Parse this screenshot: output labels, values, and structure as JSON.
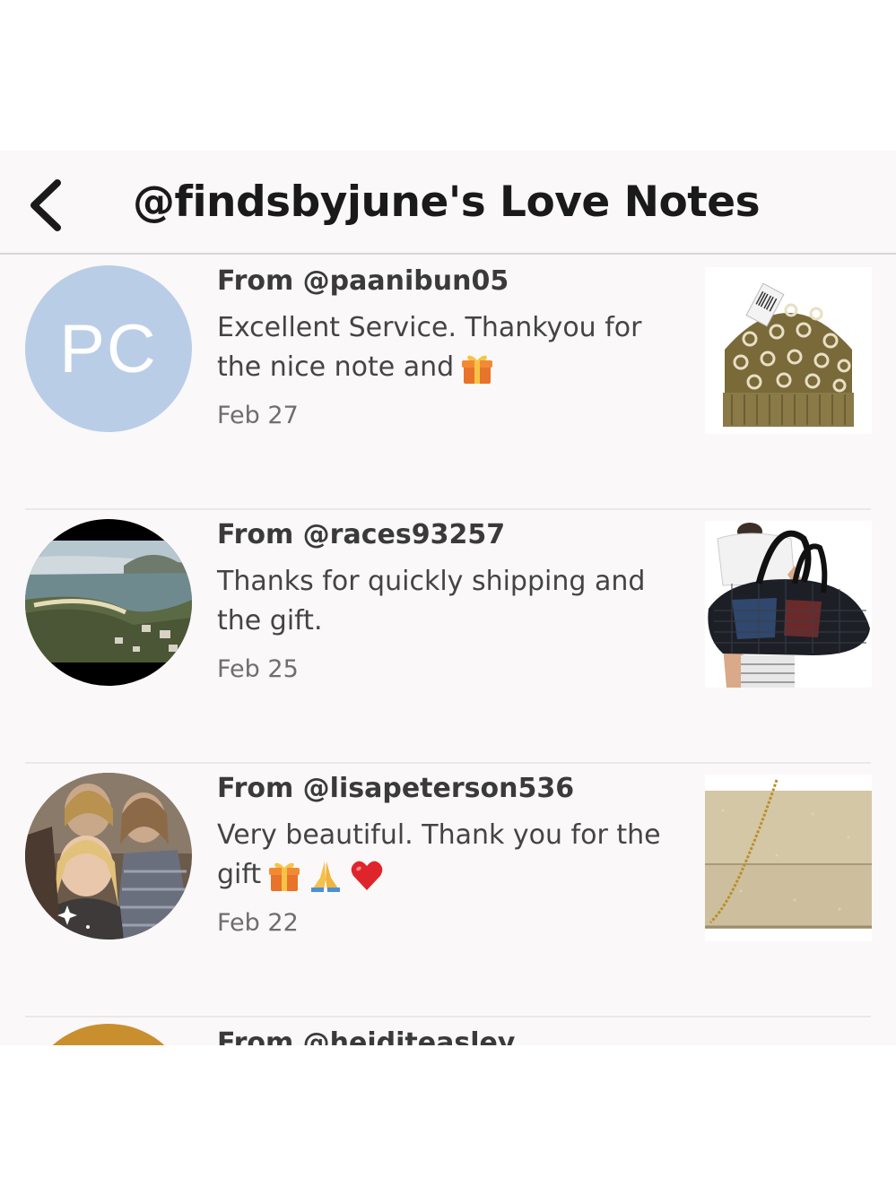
{
  "header": {
    "title": "@findsbyjune's Love Notes",
    "back_icon": "chevron-left-icon"
  },
  "notes": [
    {
      "avatar_initials": "PC",
      "avatar_color": "#b9cde6",
      "from": "From @paanibun05",
      "message": "Excellent Service. Thankyou for the nice note and",
      "emojis": [
        "gift-emoji"
      ],
      "date": "Feb 27",
      "item": "knit-beanie-thumbnail"
    },
    {
      "avatar_initials": "",
      "from": "From @races93257",
      "message": "Thanks for quickly shipping and the gift.",
      "emojis": [],
      "date": "Feb 25",
      "item": "mesh-duffel-bag-thumbnail"
    },
    {
      "avatar_initials": "",
      "from": "From @lisapeterson536",
      "message": "Very beautiful. Thank you for the gift",
      "emojis": [
        "gift-emoji",
        "folded-hands-emoji",
        "red-heart-emoji"
      ],
      "date": "Feb 22",
      "item": "glitter-clutch-thumbnail"
    },
    {
      "from": "From @heiditeasley"
    }
  ]
}
